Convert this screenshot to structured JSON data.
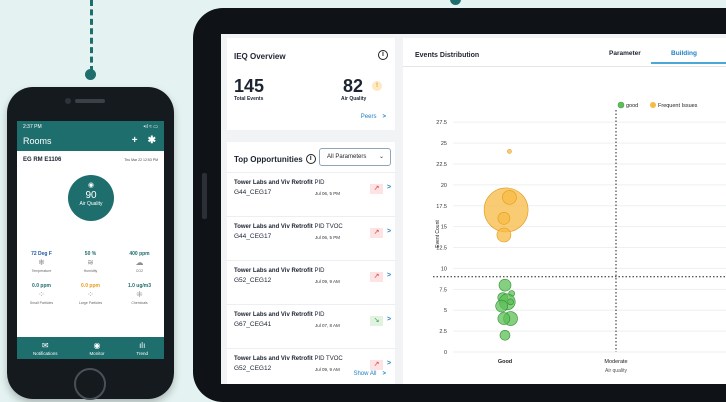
{
  "phone": {
    "status_time": "2:37 PM",
    "status_icons": "•ıl ≈ ▭",
    "title": "Rooms",
    "add_icon": "+",
    "settings_icon": "✱",
    "room_name": "EG RM E1106",
    "room_date": "Thu Mar 22 12:53 PM",
    "air_quality_value": "90",
    "air_quality_label": "Air Quality",
    "metrics": [
      {
        "value": "72 Deg F",
        "label": "Temperature",
        "icon": "❄",
        "color": "#1f5aa6"
      },
      {
        "value": "50 %",
        "label": "Humidity",
        "icon": "≋",
        "color": "#1f6e6e"
      },
      {
        "value": "400 ppm",
        "label": "CO2",
        "icon": "☁",
        "color": "#1f6e6e"
      },
      {
        "value": "0.0 ppm",
        "label": "Small Particles",
        "icon": "⁘",
        "color": "#1f6e6e"
      },
      {
        "value": "0.0 ppm",
        "label": "Large Particles",
        "icon": "⁘",
        "color": "#e89c1a"
      },
      {
        "value": "1.0 ug/m3",
        "label": "Chemicals",
        "icon": "⁜",
        "color": "#1f6e6e"
      }
    ],
    "nav": [
      {
        "label": "Notifications",
        "icon": "✉"
      },
      {
        "label": "Monitor",
        "icon": "◉"
      },
      {
        "label": "Trend",
        "icon": "ılı"
      }
    ]
  },
  "tablet": {
    "ieq": {
      "title": "IEQ Overview",
      "info_icon": "i",
      "total_events": "145",
      "total_events_label": "Total Events",
      "air_quality": "82",
      "air_quality_badge": "!",
      "air_quality_label": "Air Quality",
      "peers_link": "Peers",
      "peers_chevron": ">"
    },
    "top_opportunities": {
      "title": "Top Opportunities",
      "info_icon": "i",
      "select_value": "All Parameters",
      "select_chevron": "⌄",
      "rows": [
        {
          "building": "Tower Labs and Viv Retrofit",
          "metric": "PID",
          "code": "G44_CEG17",
          "date": "Jul 06, 5 PM",
          "trend": "↗",
          "dir": "up"
        },
        {
          "building": "Tower Labs and Viv Retrofit",
          "metric": "PID TVOC",
          "code": "G44_CEG17",
          "date": "Jul 06, 5 PM",
          "trend": "↗",
          "dir": "up"
        },
        {
          "building": "Tower Labs and Viv Retrofit",
          "metric": "PID",
          "code": "G52_CEG12",
          "date": "Jul 09, 9 AM",
          "trend": "↗",
          "dir": "up"
        },
        {
          "building": "Tower Labs and Viv Retrofit",
          "metric": "PID",
          "code": "G67_CEG41",
          "date": "Jul 07, 8 AM",
          "trend": "↘",
          "dir": "down"
        },
        {
          "building": "Tower Labs and Viv Retrofit",
          "metric": "PID TVOC",
          "code": "G52_CEG12",
          "date": "Jul 09, 9 AM",
          "trend": "↗",
          "dir": "up"
        }
      ],
      "row_chevron": ">",
      "show_all": "Show All",
      "show_all_chevron": ">"
    },
    "events": {
      "title": "Events Distribution",
      "tab_parameter": "Parameter",
      "tab_building": "Building"
    }
  },
  "chart_data": {
    "type": "scatter",
    "title": "Events Distribution",
    "xlabel": "Air quality",
    "ylabel": "Event Count",
    "x_categories": [
      "Good",
      "Moderate"
    ],
    "ylim": [
      0,
      28
    ],
    "yticks": [
      "0",
      "2.5",
      "5",
      "7.5",
      "10",
      "12.5",
      "15",
      "17.5",
      "20",
      "22.5",
      "25",
      "27.5"
    ],
    "ytick_values": [
      0,
      2.5,
      5,
      7.5,
      10,
      12.5,
      15,
      17.5,
      20,
      22.5,
      25,
      27.5
    ],
    "threshold_y": 9,
    "legend_position": "top-right",
    "series": [
      {
        "name": "good",
        "color": "#5cbf57",
        "points": [
          {
            "x": 0,
            "y": 8,
            "size": 6
          },
          {
            "x": 0.06,
            "y": 7,
            "size": 3
          },
          {
            "x": -0.02,
            "y": 6.5,
            "size": 5
          },
          {
            "x": 0.02,
            "y": 6,
            "size": 8
          },
          {
            "x": -0.03,
            "y": 5.5,
            "size": 6
          },
          {
            "x": 0.05,
            "y": 4,
            "size": 7
          },
          {
            "x": -0.01,
            "y": 4,
            "size": 6
          },
          {
            "x": 0,
            "y": 2,
            "size": 5
          },
          {
            "x": 0.05,
            "y": 6,
            "size": 3
          }
        ]
      },
      {
        "name": "Frequent Issues",
        "color": "#f7bb45",
        "points": [
          {
            "x": 0.01,
            "y": 17,
            "size": 22
          },
          {
            "x": 0.04,
            "y": 18.5,
            "size": 7
          },
          {
            "x": -0.01,
            "y": 16,
            "size": 6
          },
          {
            "x": -0.01,
            "y": 14,
            "size": 7
          },
          {
            "x": 0.04,
            "y": 24,
            "size": 2
          }
        ]
      }
    ]
  }
}
